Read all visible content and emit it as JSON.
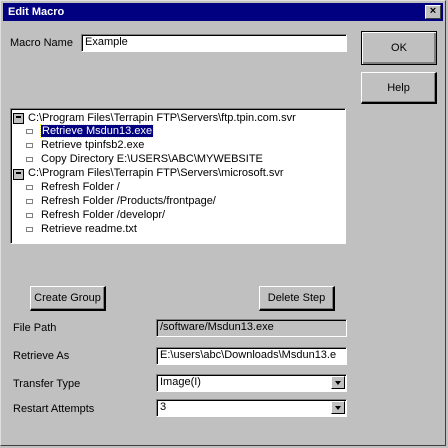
{
  "window": {
    "title": "Edit Macro",
    "close_glyph": "×"
  },
  "macro_name": {
    "label": "Macro Name",
    "value": "Example"
  },
  "buttons": {
    "ok": "OK",
    "help": "Help",
    "create_group": "Create Group",
    "delete_step": "Delete Step"
  },
  "tree": {
    "groups": [
      {
        "label": "C:\\Program Files\\Terrapin FTP\\Servers\\ftp.tpin.com.svr",
        "items": [
          "Retrieve Msdun13.exe",
          "Retrieve tpinfsb2.exe",
          "Copy Directory E:\\USERS\\ABC\\MYWEBSITE"
        ]
      },
      {
        "label": "C:\\Program Files\\Terrapin FTP\\Servers\\microsoft.svr",
        "items": [
          "Refresh Folder /",
          "Refresh Folder /Products/frontpage/",
          "Refresh Folder /developr/",
          "Retrieve readme.txt"
        ]
      }
    ]
  },
  "fields": {
    "file_path": {
      "label": "File Path",
      "value": "/software/Msdun13.exe"
    },
    "retrieve_as": {
      "label": "Retrieve As",
      "value": "E:\\users\\abc\\Downloads\\Msdun13.e"
    },
    "transfer_type": {
      "label": "Transfer Type",
      "value": "Image(I)"
    },
    "restart_attempts": {
      "label": "Restart Attempts",
      "value": "3"
    }
  }
}
